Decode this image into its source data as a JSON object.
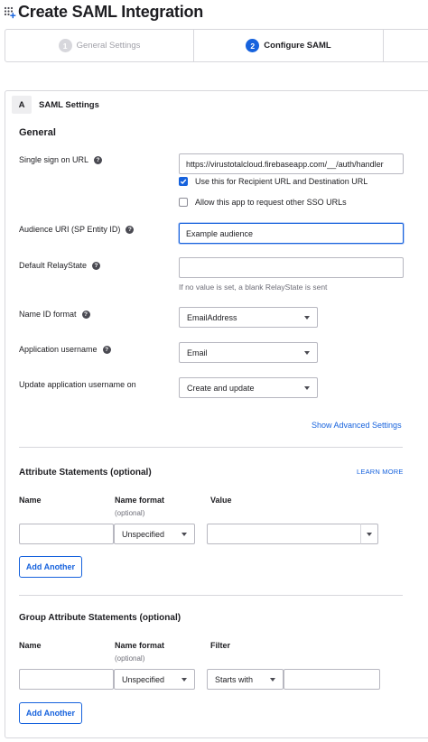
{
  "header": {
    "title": "Create SAML Integration"
  },
  "steps": [
    {
      "number": "1",
      "label": "General Settings",
      "state": "inactive"
    },
    {
      "number": "2",
      "label": "Configure SAML",
      "state": "active"
    }
  ],
  "section": {
    "letter": "A",
    "title": "SAML Settings"
  },
  "general": {
    "heading": "General",
    "sso_url": {
      "label": "Single sign on URL",
      "value": "https://virustotalcloud.firebaseapp.com/__/auth/handler",
      "recipient_checkbox": {
        "label": "Use this for Recipient URL and Destination URL",
        "checked": true
      },
      "other_sso_checkbox": {
        "label": "Allow this app to request other SSO URLs",
        "checked": false
      }
    },
    "audience_uri": {
      "label": "Audience URI (SP Entity ID)",
      "value": "Example audience"
    },
    "relay_state": {
      "label": "Default RelayState",
      "value": "",
      "hint": "If no value is set, a blank RelayState is sent"
    },
    "name_id_format": {
      "label": "Name ID format",
      "selected": "EmailAddress"
    },
    "app_username": {
      "label": "Application username",
      "selected": "Email"
    },
    "update_username": {
      "label": "Update application username on",
      "selected": "Create and update"
    },
    "advanced_link": "Show Advanced Settings"
  },
  "attribute_statements": {
    "heading": "Attribute Statements (optional)",
    "learn_more": "LEARN MORE",
    "columns": {
      "name": "Name",
      "name_format": "Name format",
      "optional": "(optional)",
      "value": "Value"
    },
    "row": {
      "name": "",
      "format": "Unspecified",
      "value": ""
    },
    "add_button": "Add Another"
  },
  "group_attribute_statements": {
    "heading": "Group Attribute Statements (optional)",
    "columns": {
      "name": "Name",
      "name_format": "Name format",
      "optional": "(optional)",
      "filter": "Filter"
    },
    "row": {
      "name": "",
      "format": "Unspecified",
      "filter_type": "Starts with",
      "filter_value": ""
    },
    "add_button": "Add Another"
  },
  "colors": {
    "accent": "#1662dd",
    "border": "#d7d7dc",
    "text": "#1d1d21",
    "muted": "#6e6e78"
  }
}
